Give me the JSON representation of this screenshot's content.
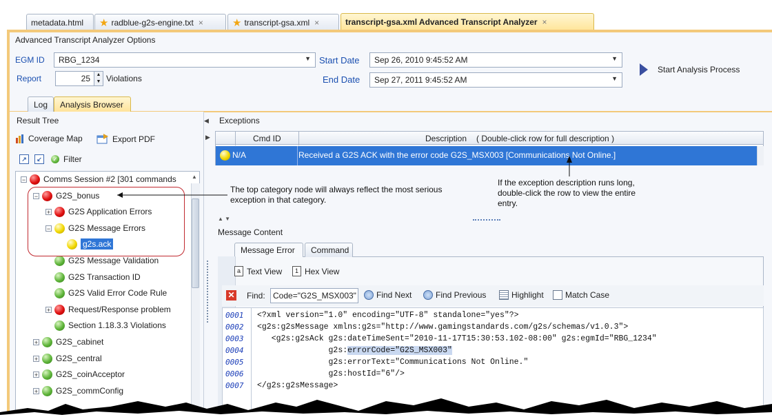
{
  "editor_tabs": [
    {
      "label": "metadata.html",
      "closable": true,
      "icon": ""
    },
    {
      "label": "radblue-g2s-engine.txt",
      "closable": true,
      "icon": "star-icon"
    },
    {
      "label": "transcript-gsa.xml",
      "closable": true,
      "icon": "star-icon"
    },
    {
      "label": "transcript-gsa.xml Advanced Transcript Analyzer",
      "closable": true,
      "icon": "",
      "active": true
    }
  ],
  "close_glyph": "×",
  "options": {
    "title": "Advanced Transcript Analyzer Options",
    "egm_id_label": "EGM ID",
    "egm_id_value": "RBG_1234",
    "report_label": "Report",
    "report_value": "25",
    "violations_label": "Violations",
    "start_date_label": "Start Date",
    "start_date_value": "Sep 26, 2010 9:45:52 AM",
    "end_date_label": "End Date",
    "end_date_value": "Sep 27, 2011 9:45:52 AM",
    "start_button": "Start Analysis Process"
  },
  "view_tabs": [
    {
      "label": "Log"
    },
    {
      "label": "Analysis Browser",
      "active": true
    }
  ],
  "result_tree": {
    "title": "Result Tree",
    "coverage_map": "Coverage Map",
    "export_pdf": "Export PDF",
    "filter": "Filter",
    "nodes": [
      {
        "label": "Comms Session #2 [301 commands",
        "status": "red",
        "expander": "−",
        "depth": 0
      },
      {
        "label": "G2S_bonus",
        "status": "red",
        "expander": "−",
        "depth": 1
      },
      {
        "label": "G2S Application Errors",
        "status": "red",
        "expander": "+",
        "depth": 2
      },
      {
        "label": "G2S Message Errors",
        "status": "yellow",
        "expander": "−",
        "depth": 2
      },
      {
        "label": "g2s.ack",
        "status": "yellow",
        "expander": "",
        "depth": 3,
        "selected": true
      },
      {
        "label": "G2S Message Validation",
        "status": "green",
        "expander": "",
        "depth": 2
      },
      {
        "label": "G2S Transaction ID",
        "status": "green",
        "expander": "",
        "depth": 2
      },
      {
        "label": "G2S Valid Error Code Rule",
        "status": "green",
        "expander": "",
        "depth": 2
      },
      {
        "label": "Request/Response problem",
        "status": "red",
        "expander": "+",
        "depth": 2
      },
      {
        "label": "Section 1.18.3.3 Violations",
        "status": "green",
        "expander": "",
        "depth": 2
      },
      {
        "label": "G2S_cabinet",
        "status": "green",
        "expander": "+",
        "depth": 1
      },
      {
        "label": "G2S_central",
        "status": "green",
        "expander": "+",
        "depth": 1
      },
      {
        "label": "G2S_coinAcceptor",
        "status": "green",
        "expander": "+",
        "depth": 1
      },
      {
        "label": "G2S_commConfig",
        "status": "green",
        "expander": "+",
        "depth": 1
      }
    ]
  },
  "exceptions": {
    "title": "Exceptions",
    "col_cmd_id": "Cmd ID",
    "col_description": "Description",
    "col_hint": "( Double-click row for full description )",
    "rows": [
      {
        "cmd_id": "N/A",
        "description": "Received a G2S ACK with the error code G2S_MSX003 [Communications Not Online.]",
        "status": "yellow"
      }
    ]
  },
  "message_content": {
    "title": "Message Content",
    "tabs": [
      {
        "label": "Message Error",
        "active": true
      },
      {
        "label": "Command"
      }
    ],
    "text_view": "Text View",
    "hex_view": "Hex View",
    "find_label": "Find:",
    "find_value": "Code=\"G2S_MSX003\"",
    "find_next": "Find Next",
    "find_previous": "Find Previous",
    "highlight": "Highlight",
    "match_case": "Match Case",
    "lines": [
      {
        "num": "0001",
        "text": "<?xml version=\"1.0\" encoding=\"UTF-8\" standalone=\"yes\"?>"
      },
      {
        "num": "0002",
        "text": "<g2s:g2sMessage xmlns:g2s=\"http://www.gamingstandards.com/g2s/schemas/v1.0.3\">"
      },
      {
        "num": "0003",
        "text": "   <g2s:g2sAck g2s:dateTimeSent=\"2010-11-17T15:30:53.102-08:00\" g2s:egmId=\"RBG_1234\""
      },
      {
        "num": "0004",
        "pre": "               g2s:",
        "hl": "errorCode=\"G2S_MSX003\"",
        "text": ""
      },
      {
        "num": "0005",
        "text": "               g2s:errorText=\"Communications Not Online.\""
      },
      {
        "num": "0006",
        "text": "               g2s:hostId=\"6\"/>"
      },
      {
        "num": "0007",
        "text": "</g2s:g2sMessage>"
      }
    ]
  },
  "annotations": {
    "tree_note": "The top category node will always reflect the most serious exception in that category.",
    "exception_note": "If the exception description runs long, double-click the row to view the entire entry."
  },
  "colors": {
    "frame": "#f3c97a",
    "selection": "#2f76d6",
    "label_blue": "#1a4fb0",
    "callout": "#c0282e"
  }
}
